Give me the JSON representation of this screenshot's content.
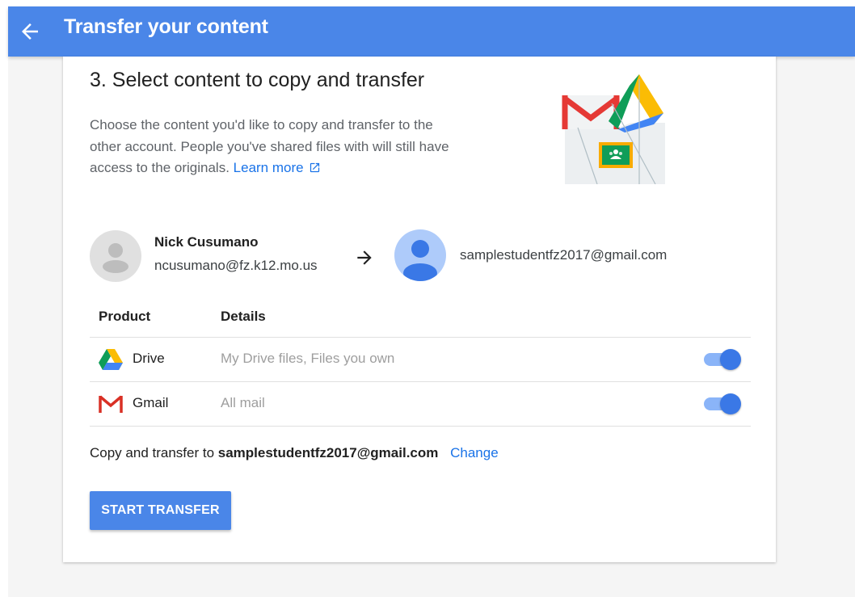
{
  "header": {
    "title": "Transfer your content",
    "back_icon": "arrow-left-icon",
    "color": "#4a86e8"
  },
  "step": {
    "title": "3. Select content to copy and transfer",
    "description": "Choose the content you'd like to copy and transfer to the other account. People you've shared files with will still have access to the originals.",
    "learn_more": "Learn more",
    "learn_more_icon": "open-in-new-icon"
  },
  "accounts": {
    "source": {
      "name": "Nick Cusumano",
      "email": "ncusumano@fz.k12.mo.us"
    },
    "destination": {
      "email": "samplestudentfz2017@gmail.com"
    },
    "arrow_icon": "arrow-right-icon"
  },
  "table": {
    "headers": [
      "Product",
      "Details"
    ],
    "rows": [
      {
        "product": "Drive",
        "icon": "google-drive-icon",
        "details": "My Drive files, Files you own",
        "enabled": true
      },
      {
        "product": "Gmail",
        "icon": "gmail-icon",
        "details": "All mail",
        "enabled": true
      }
    ]
  },
  "footer": {
    "copy_prefix": "Copy and transfer to",
    "copy_target": "samplestudentfz2017@gmail.com",
    "change_label": "Change",
    "start_button": "START TRANSFER"
  },
  "colors": {
    "accent": "#4a86e8",
    "link": "#1a73e8",
    "toggle_on": "#3a78e6"
  }
}
